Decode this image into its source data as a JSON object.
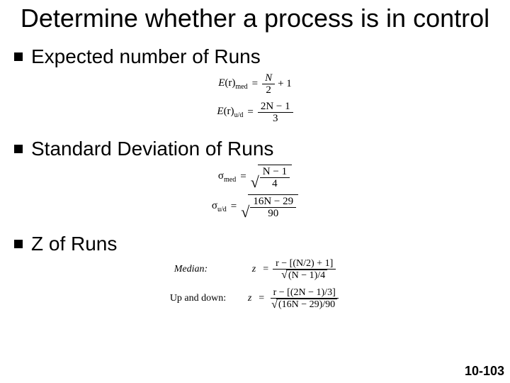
{
  "title": "Determine whether a process is in control",
  "bullets": {
    "b1": "Expected number of Runs",
    "b2": "Standard Deviation of Runs",
    "b3": "Z of Runs"
  },
  "formulas": {
    "er_med_lhs_E": "E",
    "er_med_lhs_r": "(r)",
    "er_med_sub": "med",
    "er_med_num": "N",
    "er_med_den": "2",
    "er_med_plus": "+ 1",
    "er_ud_lhs_E": "E",
    "er_ud_lhs_r": "(r)",
    "er_ud_sub": "u/d",
    "er_ud_num": "2N − 1",
    "er_ud_den": "3",
    "sd_med_sigma": "σ",
    "sd_med_sub": "med",
    "sd_med_num": "N − 1",
    "sd_med_den": "4",
    "sd_ud_sigma": "σ",
    "sd_ud_sub": "u/d",
    "sd_ud_num": "16N − 29",
    "sd_ud_den": "90",
    "z_med_label": "Median:",
    "z_med_num": "r − [(N/2) + 1]",
    "z_med_den": "(N − 1)/4",
    "z_ud_label": "Up and down:",
    "z_ud_num": "r − [(2N − 1)/3]",
    "z_ud_den": "(16N − 29)/90",
    "eq": "=",
    "z": "z"
  },
  "page": "10-103"
}
